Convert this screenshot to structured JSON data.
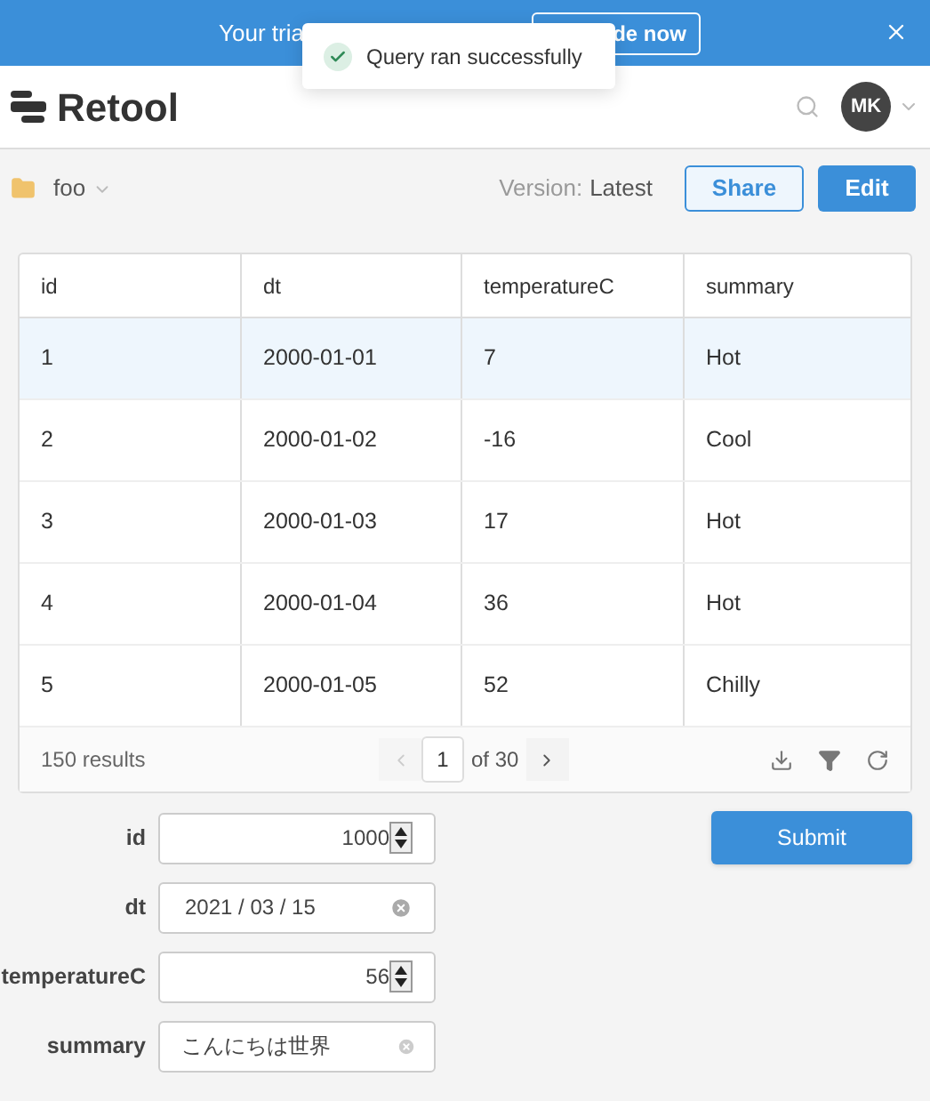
{
  "banner": {
    "text": "Your tria",
    "button": "de now"
  },
  "toast": {
    "message": "Query ran successfully"
  },
  "header": {
    "logo": "Retool",
    "avatar": "MK"
  },
  "toolbar": {
    "folder": "foo",
    "version_label": "Version:",
    "version": "Latest",
    "buttons": [
      "Share",
      "Edit"
    ]
  },
  "table": {
    "columns": [
      "id",
      "dt",
      "temperatureC",
      "summary"
    ],
    "rows": [
      {
        "cells": [
          "1",
          "2000-01-01",
          "7",
          "Hot"
        ],
        "selected": true
      },
      {
        "cells": [
          "2",
          "2000-01-02",
          "-16",
          "Cool"
        ],
        "selected": false
      },
      {
        "cells": [
          "3",
          "2000-01-03",
          "17",
          "Hot"
        ],
        "selected": false
      },
      {
        "cells": [
          "4",
          "2000-01-04",
          "36",
          "Hot"
        ],
        "selected": false
      },
      {
        "cells": [
          "5",
          "2000-01-05",
          "52",
          "Chilly"
        ],
        "selected": false
      }
    ],
    "footer": {
      "results": "150 results",
      "page": "1",
      "of": "of 30"
    }
  },
  "form": {
    "fields": [
      {
        "label": "id",
        "kind": "number",
        "value": "1000"
      },
      {
        "label": "dt",
        "kind": "date",
        "value": "2021 / 03 / 15"
      },
      {
        "label": "temperatureC",
        "kind": "number",
        "value": "56"
      },
      {
        "label": "summary",
        "kind": "text",
        "value": "こんにちは世界"
      }
    ],
    "submit": "Submit"
  }
}
